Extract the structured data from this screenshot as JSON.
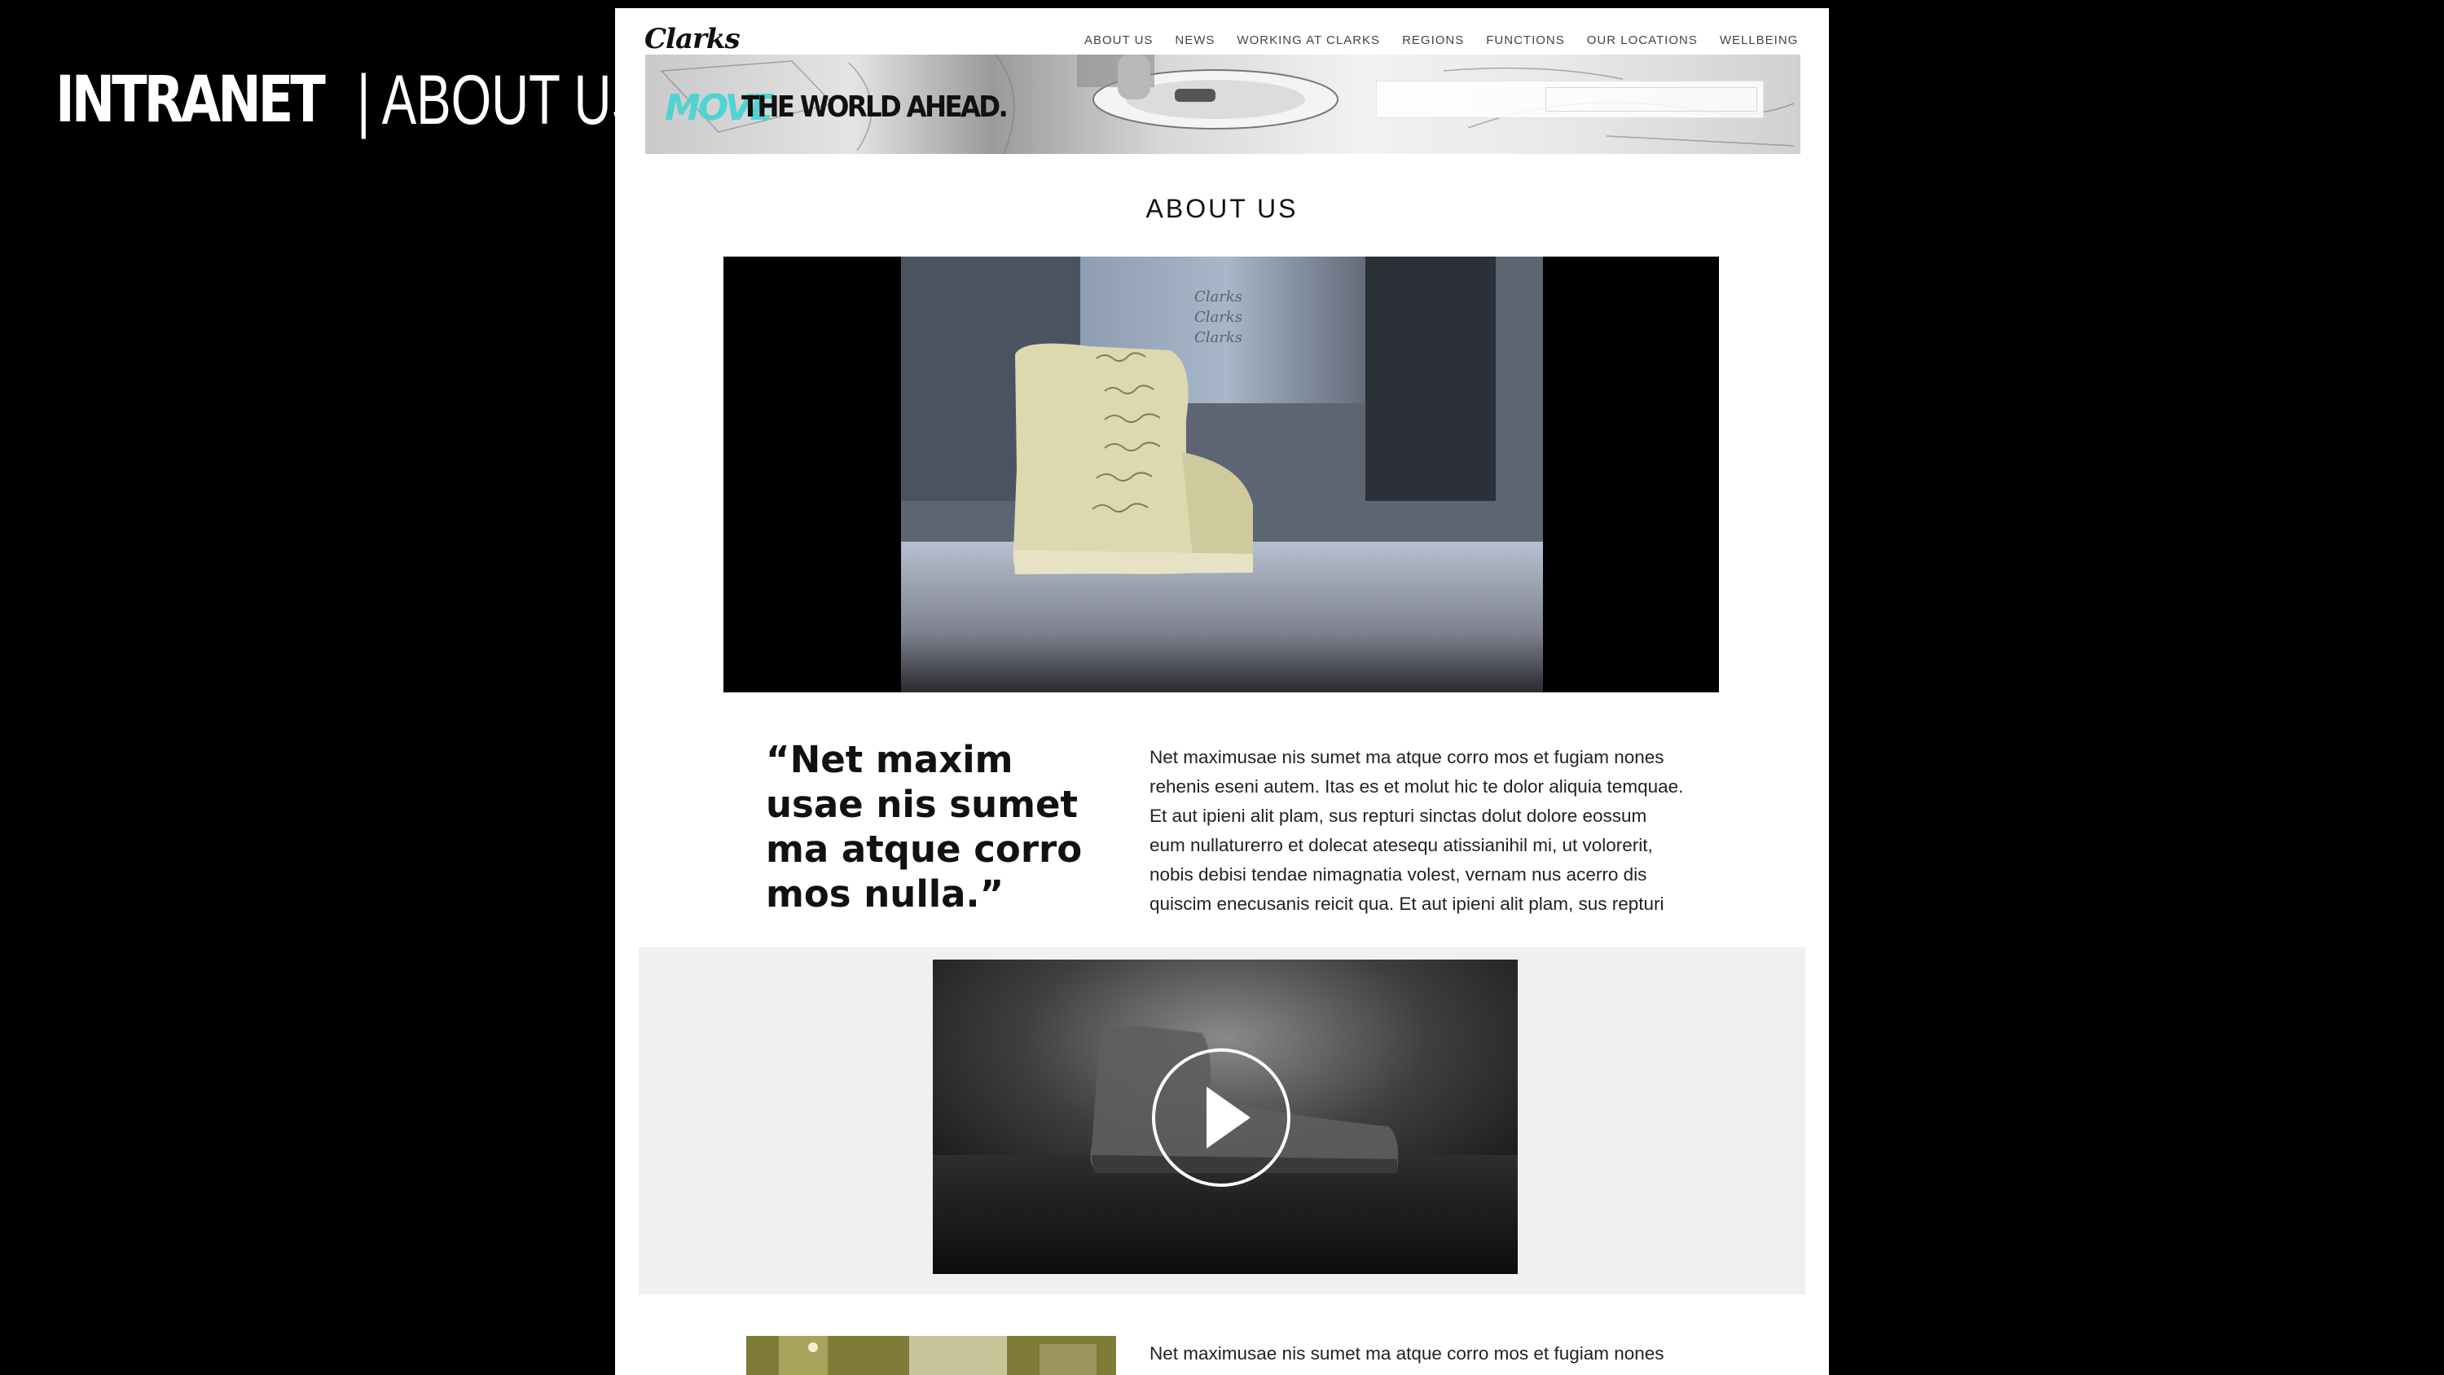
{
  "slide": {
    "heading_bold": "INTRANET",
    "heading_light": "| ABOUT US"
  },
  "site": {
    "logo": "Clarks",
    "nav": [
      "ABOUT US",
      "NEWS",
      "WORKING AT CLARKS",
      "REGIONS",
      "FUNCTIONS",
      "OUR LOCATIONS",
      "WELLBEING"
    ],
    "banner_move": "MOVE",
    "banner_tagline": "THE WORLD AHEAD.",
    "page_title": "ABOUT US",
    "hero_shoe_signatures": "Clarks",
    "quote": "“Net maxim usae nis sumet ma atque corro mos nulla.”",
    "body_lines": [
      "Net maximusae nis sumet ma atque corro mos et fugiam nones",
      "rehenis eseni autem. Itas es et molut hic te dolor aliquia temquae.",
      "Et aut ipieni alit plam, sus repturi sinctas dolut dolore eossum",
      "eum nullaturerro et dolecat atesequ atissianihil mi, ut volorerit,",
      "nobis debisi tendae nimagnatia volest, vernam nus acerro dis",
      "quiscim enecusanis reicit qua. Et aut ipieni alit plam, sus repturi"
    ],
    "lower_text": "Net maximusae nis sumet ma atque corro mos et fugiam nones"
  },
  "colors": {
    "background": "#000000",
    "page": "#ffffff",
    "accent_teal": "#4fd3d3",
    "video_band": "#f0f0f0"
  },
  "icons": {
    "play": "play-icon",
    "search": "search-box"
  }
}
